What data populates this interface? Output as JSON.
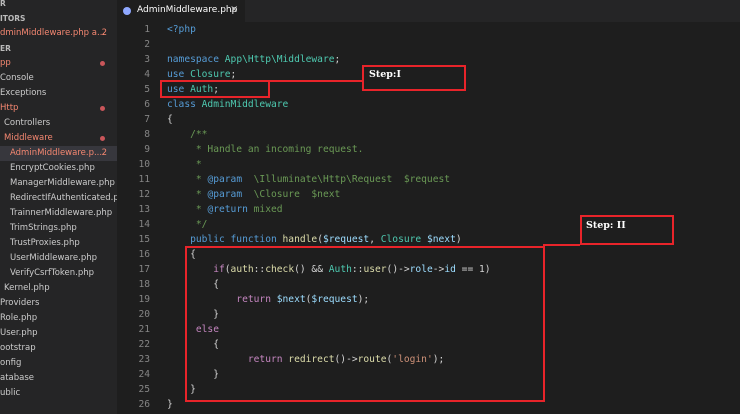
{
  "sidebar": {
    "rows": [
      {
        "text": "R",
        "cls": "head",
        "indent": 0
      },
      {
        "text": "ITORS",
        "cls": "head",
        "indent": 0
      },
      {
        "text": "dminMiddleware.php  a...",
        "cls": "red",
        "indent": 0,
        "count": "2"
      },
      {
        "text": "ER",
        "cls": "head",
        "indent": 0
      },
      {
        "text": "pp",
        "cls": "red",
        "indent": 0,
        "dot": true
      },
      {
        "text": "Console",
        "indent": 0
      },
      {
        "text": "Exceptions",
        "indent": 0
      },
      {
        "text": "Http",
        "cls": "red",
        "indent": 0,
        "dot": true
      },
      {
        "text": "Controllers",
        "indent": 4
      },
      {
        "text": "Middleware",
        "cls": "red",
        "indent": 4,
        "dot": true
      },
      {
        "text": "AdminMiddleware.p...",
        "cls": "red sel",
        "indent": 10,
        "count": "2"
      },
      {
        "text": "EncryptCookies.php",
        "indent": 10
      },
      {
        "text": "ManagerMiddleware.php",
        "indent": 10
      },
      {
        "text": "RedirectIfAuthenticated.p...",
        "indent": 10
      },
      {
        "text": "TrainnerMiddleware.php",
        "indent": 10
      },
      {
        "text": "TrimStrings.php",
        "indent": 10
      },
      {
        "text": "TrustProxies.php",
        "indent": 10
      },
      {
        "text": "UserMiddleware.php",
        "indent": 10
      },
      {
        "text": "VerifyCsrfToken.php",
        "indent": 10
      },
      {
        "text": "Kernel.php",
        "indent": 4
      },
      {
        "text": "Providers",
        "indent": 0
      },
      {
        "text": "Role.php",
        "indent": 0
      },
      {
        "text": "User.php",
        "indent": 0
      },
      {
        "text": "ootstrap",
        "indent": 0
      },
      {
        "text": "onfig",
        "indent": 0
      },
      {
        "text": "atabase",
        "indent": 0
      },
      {
        "text": "ublic",
        "indent": 0
      }
    ]
  },
  "tab": {
    "label": "AdminMiddleware.php",
    "close": "×"
  },
  "colors": {
    "keyword": "#569cd6",
    "control": "#c586c0",
    "string": "#ce9178",
    "comment": "#6a9955",
    "function": "#dcdcaa",
    "variable": "#9cdcfe",
    "class": "#4ec9b0",
    "red_box": "#e8242a"
  },
  "code_lines": [
    {
      "n": "1",
      "t": [
        [
          "<?php",
          "keyword"
        ]
      ]
    },
    {
      "n": "2",
      "t": []
    },
    {
      "n": "3",
      "t": [
        [
          "namespace ",
          "keyword"
        ],
        [
          "App\\Http\\Middleware",
          "class"
        ],
        [
          ";",
          "plain"
        ]
      ]
    },
    {
      "n": "4",
      "t": [
        [
          "use ",
          "keyword"
        ],
        [
          "Closure",
          "class"
        ],
        [
          ";",
          "plain"
        ]
      ]
    },
    {
      "n": "5",
      "t": [
        [
          "use ",
          "keyword"
        ],
        [
          "Auth",
          "class"
        ],
        [
          ";",
          "plain"
        ]
      ]
    },
    {
      "n": "6",
      "t": [
        [
          "class ",
          "keyword"
        ],
        [
          "AdminMiddleware",
          "class"
        ]
      ]
    },
    {
      "n": "7",
      "t": [
        [
          "{",
          "plain"
        ]
      ]
    },
    {
      "n": "8",
      "t": [
        [
          "    /**",
          "comment"
        ]
      ]
    },
    {
      "n": "9",
      "t": [
        [
          "     * Handle an incoming request.",
          "comment"
        ]
      ]
    },
    {
      "n": "10",
      "t": [
        [
          "     *",
          "comment"
        ]
      ]
    },
    {
      "n": "11",
      "t": [
        [
          "     * ",
          "comment"
        ],
        [
          "@param",
          "keyword"
        ],
        [
          "  \\Illuminate\\Http\\Request  $request",
          "comment"
        ]
      ]
    },
    {
      "n": "12",
      "t": [
        [
          "     * ",
          "comment"
        ],
        [
          "@param",
          "keyword"
        ],
        [
          "  \\Closure  $next",
          "comment"
        ]
      ]
    },
    {
      "n": "13",
      "t": [
        [
          "     * ",
          "comment"
        ],
        [
          "@return",
          "keyword"
        ],
        [
          " mixed",
          "comment"
        ]
      ]
    },
    {
      "n": "14",
      "t": [
        [
          "     */",
          "comment"
        ]
      ]
    },
    {
      "n": "15",
      "t": [
        [
          "    public function ",
          "keyword"
        ],
        [
          "handle",
          "function"
        ],
        [
          "(",
          "plain"
        ],
        [
          "$request",
          "variable"
        ],
        [
          ", ",
          "plain"
        ],
        [
          "Closure ",
          "class"
        ],
        [
          "$next",
          "variable"
        ],
        [
          ")",
          "plain"
        ]
      ]
    },
    {
      "n": "16",
      "t": [
        [
          "    {",
          "plain"
        ]
      ]
    },
    {
      "n": "17",
      "t": [
        [
          "        if",
          "control"
        ],
        [
          "(",
          "plain"
        ],
        [
          "auth",
          "function"
        ],
        [
          "::",
          "plain"
        ],
        [
          "check",
          "function"
        ],
        [
          "() && ",
          "plain"
        ],
        [
          "Auth",
          "class"
        ],
        [
          "::",
          "plain"
        ],
        [
          "user",
          "function"
        ],
        [
          "()->",
          "plain"
        ],
        [
          "role",
          "variable"
        ],
        [
          "->",
          "plain"
        ],
        [
          "id",
          "variable"
        ],
        [
          " == 1)",
          "plain"
        ]
      ]
    },
    {
      "n": "18",
      "t": [
        [
          "        {",
          "plain"
        ]
      ]
    },
    {
      "n": "19",
      "t": [
        [
          "            return ",
          "control"
        ],
        [
          "$next",
          "variable"
        ],
        [
          "(",
          "plain"
        ],
        [
          "$request",
          "variable"
        ],
        [
          ");",
          "plain"
        ]
      ]
    },
    {
      "n": "20",
      "t": [
        [
          "        }",
          "plain"
        ]
      ]
    },
    {
      "n": "21",
      "t": [
        [
          "     else",
          "control"
        ]
      ]
    },
    {
      "n": "22",
      "t": [
        [
          "        {",
          "plain"
        ]
      ]
    },
    {
      "n": "23",
      "t": [
        [
          "              return ",
          "control"
        ],
        [
          "redirect",
          "function"
        ],
        [
          "()->",
          "plain"
        ],
        [
          "route",
          "function"
        ],
        [
          "(",
          "plain"
        ],
        [
          "'login'",
          "string"
        ],
        [
          ");",
          "plain"
        ]
      ]
    },
    {
      "n": "24",
      "t": [
        [
          "        }",
          "plain"
        ]
      ]
    },
    {
      "n": "25",
      "t": [
        [
          "    }",
          "plain"
        ]
      ]
    },
    {
      "n": "26",
      "t": [
        [
          "}",
          "plain"
        ]
      ]
    }
  ],
  "annotations": {
    "step1": "Step:I",
    "step2": "Step: II"
  }
}
